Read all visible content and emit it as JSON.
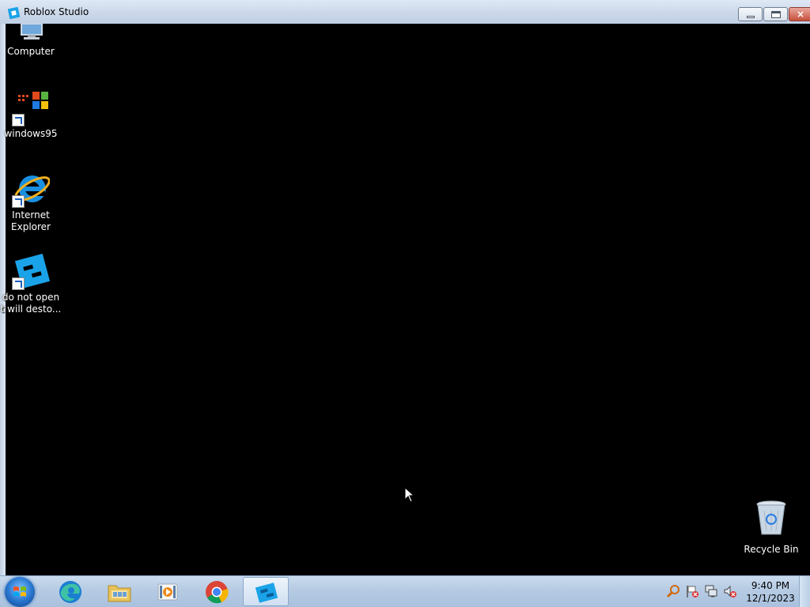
{
  "window": {
    "title": "Roblox Studio",
    "icon": "roblox-studio-icon",
    "controls": {
      "minimize": "minimize-icon",
      "maximize": "maximize-icon",
      "close": "×"
    }
  },
  "desktop": {
    "icons": [
      {
        "label": "Computer",
        "icon": "computer-icon"
      },
      {
        "label": "windows95",
        "icon": "windows95-icon",
        "shortcut": true
      },
      {
        "label": "Internet Explorer",
        "line1": "Internet",
        "line2": "Explorer",
        "icon": "internet-explorer-icon",
        "shortcut": true
      },
      {
        "label": "do not open it will desto...",
        "line1": "do not open",
        "line2": "t will desto...",
        "icon": "roblox-icon",
        "shortcut": true
      }
    ],
    "recycle_bin": {
      "label": "Recycle Bin",
      "icon": "recycle-bin-icon"
    }
  },
  "taskbar": {
    "start": "start-button",
    "apps": [
      {
        "name": "Microsoft Edge",
        "icon": "edge-icon"
      },
      {
        "name": "File Explorer",
        "icon": "folder-icon"
      },
      {
        "name": "Media Player",
        "icon": "media-player-icon"
      },
      {
        "name": "Google Chrome",
        "icon": "chrome-icon"
      },
      {
        "name": "Roblox Studio",
        "icon": "roblox-studio-icon",
        "active": true
      }
    ],
    "tray": [
      "search-icon",
      "action-center-flag-icon",
      "network-icon",
      "volume-muted-icon"
    ],
    "clock": {
      "time": "9:40 PM",
      "date": "12/1/2023"
    }
  },
  "colors": {
    "titlebar": "#cdd9ea",
    "viewport": "#000000",
    "taskbar": "#b6cbe3",
    "roblox_blue": "#1aa3e8"
  }
}
